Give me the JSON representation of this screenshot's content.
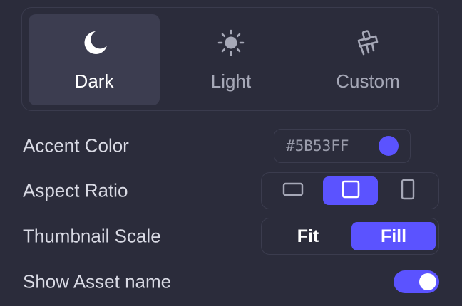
{
  "theme": {
    "options": [
      {
        "label": "Dark",
        "icon": "moon-icon",
        "active": true
      },
      {
        "label": "Light",
        "icon": "sun-icon",
        "active": false
      },
      {
        "label": "Custom",
        "icon": "paint-brush-icon",
        "active": false
      }
    ]
  },
  "accent": {
    "label": "Accent Color",
    "value": "#5B53FF",
    "swatch_color": "#5B53FF"
  },
  "aspect_ratio": {
    "label": "Aspect Ratio",
    "options": [
      "landscape-icon",
      "square-icon",
      "portrait-icon"
    ],
    "selected": "square-icon"
  },
  "thumbnail_scale": {
    "label": "Thumbnail Scale",
    "options": [
      "Fit",
      "Fill"
    ],
    "selected": "Fill"
  },
  "show_asset_name": {
    "label": "Show Asset name",
    "enabled": true
  },
  "colors": {
    "accent": "#5B53FF",
    "background": "#2B2C3B",
    "active_tile": "#3C3D50"
  }
}
